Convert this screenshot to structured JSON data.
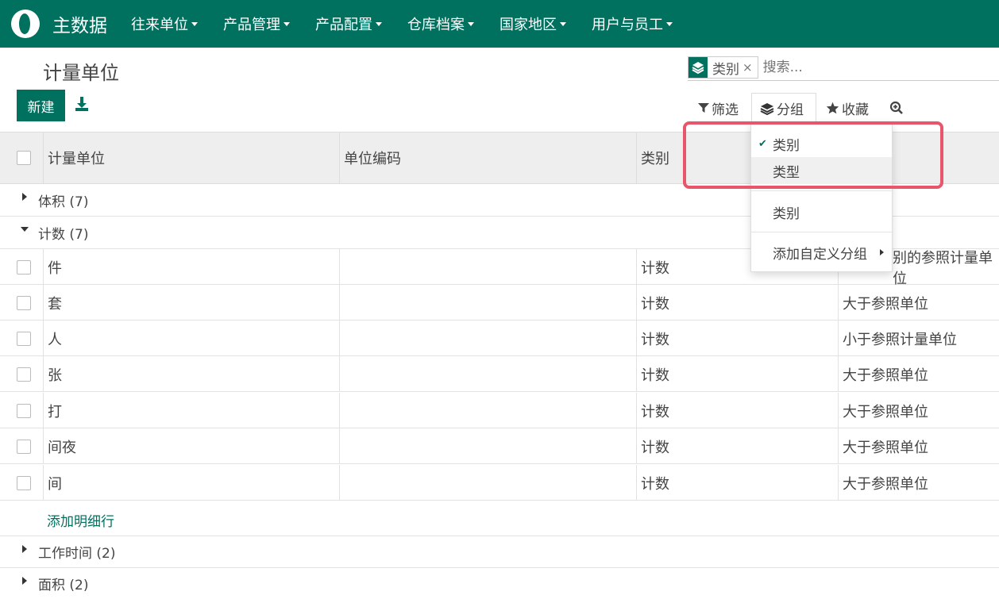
{
  "app": {
    "name": "主数据",
    "menu": [
      {
        "label": "往来单位"
      },
      {
        "label": "产品管理"
      },
      {
        "label": "产品配置"
      },
      {
        "label": "仓库档案"
      },
      {
        "label": "国家地区"
      },
      {
        "label": "用户与员工"
      }
    ]
  },
  "page": {
    "title": "计量单位",
    "new_button": "新建",
    "download_icon": "download-icon"
  },
  "search": {
    "facet_icon": "layers-icon",
    "facet_value": "类别",
    "facet_close": "×",
    "placeholder": "搜索..."
  },
  "controls": {
    "filter": "筛选",
    "group": "分组",
    "favorite": "收藏",
    "zoom_icon": "search-plus-icon"
  },
  "table": {
    "headers": {
      "name": "计量单位",
      "code": "单位编码",
      "category": "类别",
      "type_partial": "别的参照计量单位"
    },
    "groups": [
      {
        "label": "体积 (7)"
      },
      {
        "label": "计数 (7)"
      },
      {
        "label": "工作时间 (2)"
      },
      {
        "label": "面积 (2)"
      }
    ],
    "rows": [
      {
        "name": "件",
        "code": "",
        "category": "计数",
        "type": ""
      },
      {
        "name": "套",
        "code": "",
        "category": "计数",
        "type": "大于参照单位"
      },
      {
        "name": "人",
        "code": "",
        "category": "计数",
        "type": "小于参照计量单位"
      },
      {
        "name": "张",
        "code": "",
        "category": "计数",
        "type": "大于参照单位"
      },
      {
        "name": "打",
        "code": "",
        "category": "计数",
        "type": "大于参照单位"
      },
      {
        "name": "间夜",
        "code": "",
        "category": "计数",
        "type": "大于参照单位"
      },
      {
        "name": "间",
        "code": "",
        "category": "计数",
        "type": "大于参照单位"
      }
    ],
    "add_line": "添加明细行"
  },
  "group_dropdown": {
    "items": [
      {
        "label": "类别",
        "checked": "✔"
      },
      {
        "label": "类型"
      },
      {
        "label": "类别"
      },
      {
        "label": "添加自定义分组"
      }
    ]
  },
  "colors": {
    "brand": "#00705f",
    "highlight": "#e8566b"
  }
}
